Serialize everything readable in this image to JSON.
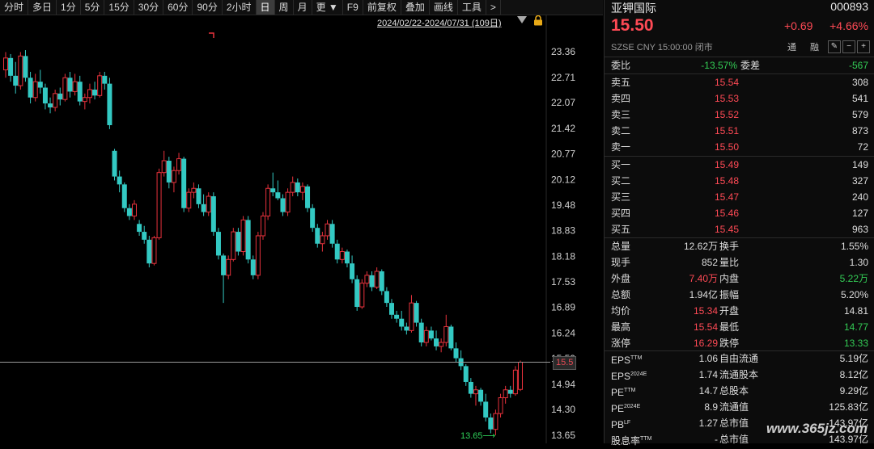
{
  "toolbar": {
    "items": [
      {
        "label": "分时",
        "active": false
      },
      {
        "label": "多日",
        "active": false
      },
      {
        "label": "1分",
        "active": false
      },
      {
        "label": "5分",
        "active": false
      },
      {
        "label": "15分",
        "active": false
      },
      {
        "label": "30分",
        "active": false
      },
      {
        "label": "60分",
        "active": false
      },
      {
        "label": "90分",
        "active": false
      },
      {
        "label": "2小时",
        "active": false
      },
      {
        "label": "日",
        "active": true
      },
      {
        "label": "周",
        "active": false
      },
      {
        "label": "月",
        "active": false
      },
      {
        "label": "更 ▼",
        "active": false
      },
      {
        "label": "F9",
        "active": false
      },
      {
        "label": "前复权",
        "active": false
      },
      {
        "label": "叠加",
        "active": false
      },
      {
        "label": "画线",
        "active": false
      },
      {
        "label": "工具",
        "active": false
      },
      {
        "label": ">",
        "active": false
      }
    ]
  },
  "chart": {
    "date_range": "2024/02/22-2024/07/31 (109日)",
    "current_price_tag": "15.5",
    "low_label": "13.65⟶",
    "watermark": "www.365jz.com"
  },
  "chart_data": {
    "type": "candlestick",
    "ylim": [
      13.55,
      23.8
    ],
    "yticks": [
      "23.36",
      "22.71",
      "22.07",
      "21.42",
      "20.77",
      "20.12",
      "19.48",
      "18.83",
      "18.18",
      "17.53",
      "16.89",
      "16.24",
      "15.59",
      "14.94",
      "14.30",
      "13.65"
    ],
    "current_price": 15.5,
    "period_low": 13.65,
    "colors": {
      "up": "#e8323c",
      "down": "#33c9c3"
    },
    "candles": [
      {
        "o": 22.9,
        "h": 23.35,
        "l": 22.7,
        "c": 23.2
      },
      {
        "o": 23.2,
        "h": 23.3,
        "l": 22.6,
        "c": 22.75
      },
      {
        "o": 22.75,
        "h": 23.1,
        "l": 22.3,
        "c": 22.5
      },
      {
        "o": 22.5,
        "h": 23.35,
        "l": 22.4,
        "c": 23.25
      },
      {
        "o": 23.25,
        "h": 23.4,
        "l": 22.6,
        "c": 22.7
      },
      {
        "o": 22.7,
        "h": 22.85,
        "l": 22.05,
        "c": 22.2
      },
      {
        "o": 22.2,
        "h": 22.8,
        "l": 22.1,
        "c": 22.6
      },
      {
        "o": 22.6,
        "h": 22.9,
        "l": 22.3,
        "c": 22.45
      },
      {
        "o": 22.45,
        "h": 22.55,
        "l": 21.9,
        "c": 22.05
      },
      {
        "o": 22.05,
        "h": 22.2,
        "l": 21.8,
        "c": 21.95
      },
      {
        "o": 21.95,
        "h": 22.4,
        "l": 21.85,
        "c": 22.3
      },
      {
        "o": 22.3,
        "h": 22.45,
        "l": 22.0,
        "c": 22.15
      },
      {
        "o": 22.15,
        "h": 22.8,
        "l": 22.1,
        "c": 22.7
      },
      {
        "o": 22.7,
        "h": 22.85,
        "l": 22.2,
        "c": 22.35
      },
      {
        "o": 22.35,
        "h": 22.8,
        "l": 22.25,
        "c": 22.6
      },
      {
        "o": 22.6,
        "h": 22.75,
        "l": 22.0,
        "c": 22.1
      },
      {
        "o": 22.1,
        "h": 22.3,
        "l": 21.9,
        "c": 22.2
      },
      {
        "o": 22.2,
        "h": 22.55,
        "l": 22.05,
        "c": 22.4
      },
      {
        "o": 22.4,
        "h": 22.6,
        "l": 22.15,
        "c": 22.25
      },
      {
        "o": 22.25,
        "h": 22.85,
        "l": 22.2,
        "c": 22.75
      },
      {
        "o": 22.75,
        "h": 22.85,
        "l": 22.4,
        "c": 22.55
      },
      {
        "o": 22.55,
        "h": 22.7,
        "l": 21.4,
        "c": 21.5
      },
      {
        "o": 20.85,
        "h": 20.9,
        "l": 20.1,
        "c": 20.2
      },
      {
        "o": 20.2,
        "h": 20.35,
        "l": 19.8,
        "c": 20.0
      },
      {
        "o": 20.0,
        "h": 20.05,
        "l": 19.3,
        "c": 19.4
      },
      {
        "o": 19.4,
        "h": 19.5,
        "l": 19.1,
        "c": 19.2
      },
      {
        "o": 19.2,
        "h": 19.6,
        "l": 19.1,
        "c": 19.5
      },
      {
        "o": 19.0,
        "h": 19.1,
        "l": 18.7,
        "c": 18.8
      },
      {
        "o": 18.8,
        "h": 18.95,
        "l": 18.5,
        "c": 18.6
      },
      {
        "o": 18.6,
        "h": 18.7,
        "l": 17.9,
        "c": 18.0
      },
      {
        "o": 18.0,
        "h": 18.7,
        "l": 17.95,
        "c": 18.65
      },
      {
        "o": 18.65,
        "h": 20.4,
        "l": 18.6,
        "c": 20.3
      },
      {
        "o": 20.3,
        "h": 20.85,
        "l": 20.2,
        "c": 20.6
      },
      {
        "o": 20.6,
        "h": 20.7,
        "l": 19.9,
        "c": 20.05
      },
      {
        "o": 20.05,
        "h": 20.45,
        "l": 19.8,
        "c": 20.35
      },
      {
        "o": 20.35,
        "h": 20.8,
        "l": 20.25,
        "c": 20.65
      },
      {
        "o": 20.65,
        "h": 20.7,
        "l": 19.3,
        "c": 19.4
      },
      {
        "o": 19.4,
        "h": 19.9,
        "l": 19.3,
        "c": 19.8
      },
      {
        "o": 19.8,
        "h": 20.05,
        "l": 19.65,
        "c": 19.9
      },
      {
        "o": 19.9,
        "h": 20.0,
        "l": 19.4,
        "c": 19.5
      },
      {
        "o": 19.5,
        "h": 19.75,
        "l": 19.2,
        "c": 19.3
      },
      {
        "o": 19.3,
        "h": 19.8,
        "l": 19.2,
        "c": 19.7
      },
      {
        "o": 19.7,
        "h": 19.8,
        "l": 18.7,
        "c": 18.8
      },
      {
        "o": 18.8,
        "h": 18.9,
        "l": 18.1,
        "c": 18.2
      },
      {
        "o": 18.2,
        "h": 18.25,
        "l": 17.0,
        "c": 17.7
      },
      {
        "o": 17.7,
        "h": 18.2,
        "l": 17.6,
        "c": 18.1
      },
      {
        "o": 18.1,
        "h": 18.9,
        "l": 18.05,
        "c": 18.8
      },
      {
        "o": 18.8,
        "h": 18.9,
        "l": 18.2,
        "c": 18.3
      },
      {
        "o": 18.3,
        "h": 19.2,
        "l": 18.2,
        "c": 19.1
      },
      {
        "o": 19.1,
        "h": 19.2,
        "l": 18.0,
        "c": 18.1
      },
      {
        "o": 18.1,
        "h": 18.2,
        "l": 17.6,
        "c": 17.7
      },
      {
        "o": 17.7,
        "h": 18.8,
        "l": 17.6,
        "c": 18.7
      },
      {
        "o": 18.7,
        "h": 19.3,
        "l": 18.6,
        "c": 19.2
      },
      {
        "o": 19.2,
        "h": 20.0,
        "l": 19.1,
        "c": 19.9
      },
      {
        "o": 19.9,
        "h": 20.3,
        "l": 19.7,
        "c": 19.8
      },
      {
        "o": 19.8,
        "h": 20.1,
        "l": 19.6,
        "c": 19.65
      },
      {
        "o": 19.65,
        "h": 19.75,
        "l": 19.2,
        "c": 19.3
      },
      {
        "o": 19.3,
        "h": 19.9,
        "l": 19.2,
        "c": 19.8
      },
      {
        "o": 19.8,
        "h": 20.2,
        "l": 19.7,
        "c": 20.05
      },
      {
        "o": 20.05,
        "h": 20.15,
        "l": 19.7,
        "c": 19.8
      },
      {
        "o": 19.8,
        "h": 20.05,
        "l": 19.6,
        "c": 19.95
      },
      {
        "o": 19.95,
        "h": 20.0,
        "l": 19.3,
        "c": 19.4
      },
      {
        "o": 19.4,
        "h": 19.5,
        "l": 18.8,
        "c": 18.9
      },
      {
        "o": 18.9,
        "h": 19.0,
        "l": 18.4,
        "c": 18.5
      },
      {
        "o": 18.5,
        "h": 18.8,
        "l": 18.3,
        "c": 18.7
      },
      {
        "o": 18.7,
        "h": 19.1,
        "l": 18.6,
        "c": 19.0
      },
      {
        "o": 19.0,
        "h": 19.1,
        "l": 18.4,
        "c": 18.5
      },
      {
        "o": 18.5,
        "h": 18.6,
        "l": 18.0,
        "c": 18.1
      },
      {
        "o": 18.1,
        "h": 18.4,
        "l": 18.0,
        "c": 18.3
      },
      {
        "o": 18.3,
        "h": 18.35,
        "l": 17.9,
        "c": 18.0
      },
      {
        "o": 18.0,
        "h": 18.2,
        "l": 17.5,
        "c": 17.6
      },
      {
        "o": 17.6,
        "h": 17.7,
        "l": 16.8,
        "c": 16.9
      },
      {
        "o": 16.9,
        "h": 17.6,
        "l": 16.85,
        "c": 17.5
      },
      {
        "o": 17.5,
        "h": 17.8,
        "l": 17.4,
        "c": 17.7
      },
      {
        "o": 17.7,
        "h": 17.8,
        "l": 17.3,
        "c": 17.4
      },
      {
        "o": 17.4,
        "h": 17.9,
        "l": 17.35,
        "c": 17.8
      },
      {
        "o": 17.8,
        "h": 17.85,
        "l": 17.2,
        "c": 17.3
      },
      {
        "o": 17.3,
        "h": 17.4,
        "l": 16.9,
        "c": 17.0
      },
      {
        "o": 17.0,
        "h": 17.1,
        "l": 16.6,
        "c": 16.7
      },
      {
        "o": 16.7,
        "h": 16.8,
        "l": 16.5,
        "c": 16.6
      },
      {
        "o": 16.6,
        "h": 16.8,
        "l": 16.3,
        "c": 16.4
      },
      {
        "o": 16.4,
        "h": 16.5,
        "l": 16.2,
        "c": 16.3
      },
      {
        "o": 16.3,
        "h": 17.2,
        "l": 16.25,
        "c": 17.0
      },
      {
        "o": 17.0,
        "h": 17.05,
        "l": 16.4,
        "c": 16.5
      },
      {
        "o": 16.5,
        "h": 16.6,
        "l": 15.9,
        "c": 16.0
      },
      {
        "o": 16.0,
        "h": 16.4,
        "l": 15.9,
        "c": 16.3
      },
      {
        "o": 16.3,
        "h": 16.4,
        "l": 16.05,
        "c": 16.1
      },
      {
        "o": 16.1,
        "h": 16.3,
        "l": 15.8,
        "c": 15.9
      },
      {
        "o": 15.9,
        "h": 16.1,
        "l": 15.75,
        "c": 16.0
      },
      {
        "o": 16.0,
        "h": 16.7,
        "l": 15.9,
        "c": 16.4
      },
      {
        "o": 16.4,
        "h": 16.45,
        "l": 15.8,
        "c": 15.85
      },
      {
        "o": 15.85,
        "h": 16.0,
        "l": 15.5,
        "c": 15.6
      },
      {
        "o": 15.6,
        "h": 15.8,
        "l": 15.3,
        "c": 15.4
      },
      {
        "o": 15.4,
        "h": 15.45,
        "l": 14.9,
        "c": 15.0
      },
      {
        "o": 15.0,
        "h": 15.1,
        "l": 14.6,
        "c": 14.7
      },
      {
        "o": 14.7,
        "h": 14.9,
        "l": 14.4,
        "c": 14.8
      },
      {
        "o": 14.8,
        "h": 14.85,
        "l": 14.4,
        "c": 14.5
      },
      {
        "o": 14.5,
        "h": 14.7,
        "l": 14.0,
        "c": 14.1
      },
      {
        "o": 14.1,
        "h": 14.2,
        "l": 13.7,
        "c": 13.8
      },
      {
        "o": 13.8,
        "h": 14.3,
        "l": 13.65,
        "c": 14.2
      },
      {
        "o": 14.2,
        "h": 14.7,
        "l": 14.1,
        "c": 14.6
      },
      {
        "o": 14.6,
        "h": 14.9,
        "l": 14.45,
        "c": 14.8
      },
      {
        "o": 14.8,
        "h": 14.9,
        "l": 14.6,
        "c": 14.7
      },
      {
        "o": 14.7,
        "h": 15.4,
        "l": 14.65,
        "c": 15.3
      },
      {
        "o": 14.81,
        "h": 15.54,
        "l": 14.77,
        "c": 15.5
      }
    ]
  },
  "quote": {
    "name": "亚钾国际",
    "code": "000893",
    "price": "15.50",
    "change": "+0.69",
    "change_pct": "+4.66%",
    "exchange": "SZSE",
    "currency": "CNY",
    "time": "15:00:00",
    "status": "闭市",
    "tag1": "通",
    "tag2": "融"
  },
  "committee": {
    "ratio_label": "委比",
    "ratio": "-13.57%",
    "diff_label": "委差",
    "diff": "-567"
  },
  "asks": [
    {
      "label": "卖五",
      "price": "15.54",
      "vol": "308"
    },
    {
      "label": "卖四",
      "price": "15.53",
      "vol": "541"
    },
    {
      "label": "卖三",
      "price": "15.52",
      "vol": "579"
    },
    {
      "label": "卖二",
      "price": "15.51",
      "vol": "873"
    },
    {
      "label": "卖一",
      "price": "15.50",
      "vol": "72"
    }
  ],
  "bids": [
    {
      "label": "买一",
      "price": "15.49",
      "vol": "149"
    },
    {
      "label": "买二",
      "price": "15.48",
      "vol": "327"
    },
    {
      "label": "买三",
      "price": "15.47",
      "vol": "240"
    },
    {
      "label": "买四",
      "price": "15.46",
      "vol": "127"
    },
    {
      "label": "买五",
      "price": "15.45",
      "vol": "963"
    }
  ],
  "stats": [
    {
      "l1": "总量",
      "v1": "12.62万",
      "c1": "white",
      "l2": "换手",
      "v2": "1.55%",
      "c2": "white"
    },
    {
      "l1": "现手",
      "v1": "852",
      "c1": "white",
      "l2": "量比",
      "v2": "1.30",
      "c2": "white"
    },
    {
      "l1": "外盘",
      "v1": "7.40万",
      "c1": "red",
      "l2": "内盘",
      "v2": "5.22万",
      "c2": "green"
    },
    {
      "l1": "总额",
      "v1": "1.94亿",
      "c1": "white",
      "l2": "振幅",
      "v2": "5.20%",
      "c2": "white"
    },
    {
      "l1": "均价",
      "v1": "15.34",
      "c1": "red",
      "l2": "开盘",
      "v2": "14.81",
      "c2": "white"
    },
    {
      "l1": "最高",
      "v1": "15.54",
      "c1": "red",
      "l2": "最低",
      "v2": "14.77",
      "c2": "green"
    },
    {
      "l1": "涨停",
      "v1": "16.29",
      "c1": "red",
      "l2": "跌停",
      "v2": "13.33",
      "c2": "green"
    }
  ],
  "fundamentals": [
    {
      "l1": "EPS",
      "sup": "TTM",
      "v1": "1.06",
      "l2": "自由流通",
      "v2": "5.19亿"
    },
    {
      "l1": "EPS",
      "sup": "2024E",
      "v1": "1.74",
      "l2": "流通股本",
      "v2": "8.12亿"
    },
    {
      "l1": "PE",
      "sup": "TTM",
      "v1": "14.7",
      "l2": "总股本",
      "v2": "9.29亿"
    },
    {
      "l1": "PE",
      "sup": "2024E",
      "v1": "8.9",
      "l2": "流通值",
      "v2": "125.83亿"
    },
    {
      "l1": "PB",
      "sup": "LF",
      "v1": "1.27",
      "l2": "总市值",
      "v2": "143.97亿"
    },
    {
      "l1": "股息率",
      "sup": "TTM",
      "v1": "-",
      "l2": "总市值",
      "v2": "143.97亿"
    }
  ]
}
